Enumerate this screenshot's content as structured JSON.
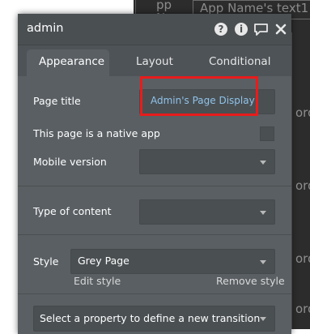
{
  "background_editor": {
    "labels": [
      "pp",
      "Name",
      "App Name's text1",
      "ord",
      "ord",
      "ord",
      "ord"
    ]
  },
  "panel": {
    "title": "admin",
    "header_icons": [
      "help-icon",
      "info-icon",
      "comment-icon",
      "close-icon"
    ],
    "tabs": [
      {
        "label": "Appearance",
        "active": true
      },
      {
        "label": "Layout",
        "active": false
      },
      {
        "label": "Conditional",
        "active": false
      }
    ],
    "page_title": {
      "label": "Page title",
      "value": "Admin's Page Display"
    },
    "native_app": {
      "label": "This page is a native app",
      "checked": false
    },
    "mobile_version": {
      "label": "Mobile version",
      "value": ""
    },
    "type_of_content": {
      "label": "Type of content",
      "value": ""
    },
    "style": {
      "label": "Style",
      "value": "Grey Page",
      "edit_label": "Edit style",
      "remove_label": "Remove style"
    },
    "transition": {
      "placeholder": "Select a property to define a new transition"
    }
  },
  "colors": {
    "panel_bg": "#5a5f63",
    "field_bg": "#4a4f52",
    "link_blue": "#8fc3ea",
    "highlight_red": "#e81c1c"
  }
}
